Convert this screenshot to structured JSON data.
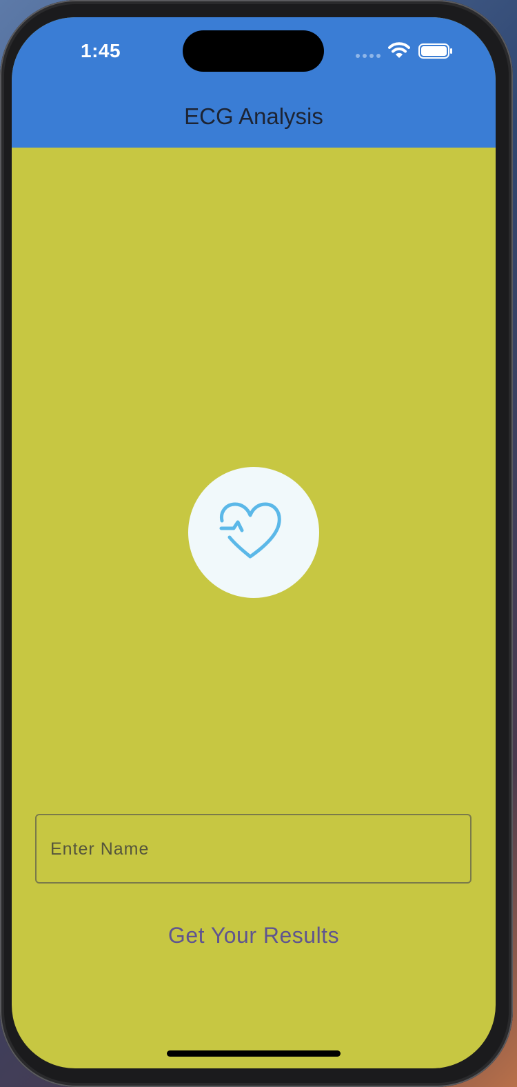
{
  "status_bar": {
    "time": "1:45"
  },
  "app_bar": {
    "title": "ECG Analysis"
  },
  "logo": {
    "icon": "heart-pulse-icon"
  },
  "name_input": {
    "placeholder": "Enter Name",
    "value": ""
  },
  "results_button": {
    "label": "Get Your Results"
  },
  "colors": {
    "app_bar": "#3a7dd5",
    "background": "#c7c742",
    "logo_circle": "#f1f9fb",
    "heart_icon": "#5bb8e8",
    "button_text": "#5f5490"
  }
}
